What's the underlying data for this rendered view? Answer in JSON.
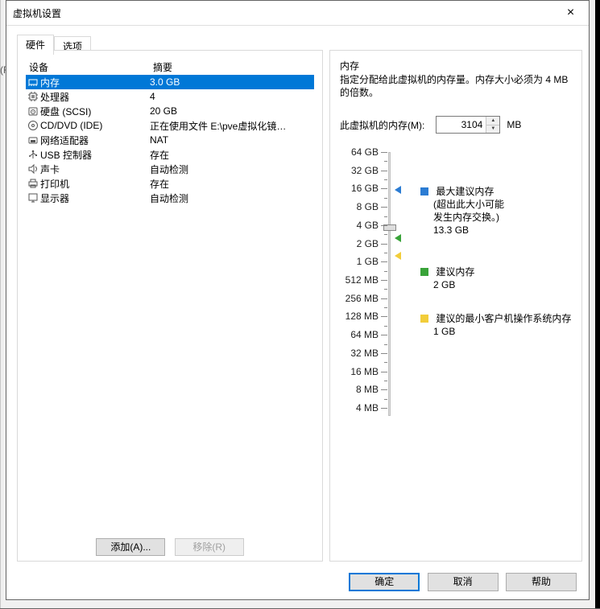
{
  "title": "虚拟机设置",
  "close_label": "×",
  "tabs": {
    "hardware": "硬件",
    "options": "选项"
  },
  "device_header": {
    "device": "设备",
    "summary": "摘要"
  },
  "devices": [
    {
      "name": "内存",
      "summary": "3.0 GB",
      "icon": "memory-icon",
      "selected": true
    },
    {
      "name": "处理器",
      "summary": "4",
      "icon": "cpu-icon"
    },
    {
      "name": "硬盘 (SCSI)",
      "summary": "20 GB",
      "icon": "hdd-icon"
    },
    {
      "name": "CD/DVD (IDE)",
      "summary": "正在使用文件 E:\\pve虚拟化镜…",
      "icon": "disc-icon"
    },
    {
      "name": "网络适配器",
      "summary": "NAT",
      "icon": "nic-icon"
    },
    {
      "name": "USB 控制器",
      "summary": "存在",
      "icon": "usb-icon"
    },
    {
      "name": "声卡",
      "summary": "自动检测",
      "icon": "sound-icon"
    },
    {
      "name": "打印机",
      "summary": "存在",
      "icon": "printer-icon"
    },
    {
      "name": "显示器",
      "summary": "自动检测",
      "icon": "display-icon"
    }
  ],
  "left_buttons": {
    "add": "添加(A)...",
    "remove": "移除(R)"
  },
  "memory": {
    "heading": "内存",
    "desc": "指定分配给此虚拟机的内存量。内存大小必须为 4 MB 的倍数。",
    "label": "此虚拟机的内存(M):",
    "value": "3104",
    "unit": "MB",
    "ticks": [
      "64 GB",
      "32 GB",
      "16 GB",
      "8 GB",
      "4 GB",
      "2 GB",
      "1 GB",
      "512 MB",
      "256 MB",
      "128 MB",
      "64 MB",
      "32 MB",
      "16 MB",
      "8 MB",
      "4 MB"
    ]
  },
  "legend": {
    "max": {
      "title": "最大建议内存",
      "sub1": "(超出此大小可能",
      "sub2": "发生内存交换。)",
      "value": "13.3 GB"
    },
    "rec": {
      "title": "建议内存",
      "value": "2 GB"
    },
    "min": {
      "title": "建议的最小客户机操作系统内存",
      "value": "1 GB"
    }
  },
  "footer": {
    "ok": "确定",
    "cancel": "取消",
    "help": "帮助"
  },
  "bg_edge": "(R"
}
